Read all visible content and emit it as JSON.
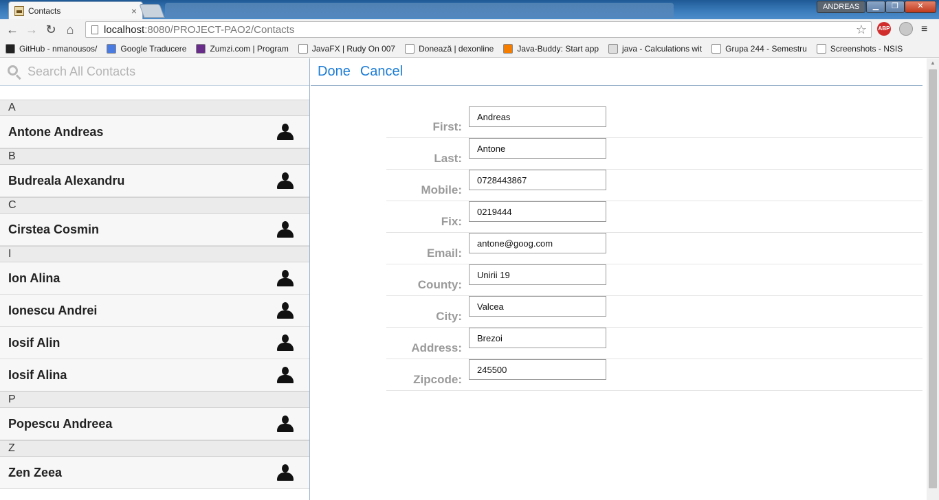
{
  "browser": {
    "tab_title": "Contacts",
    "tab_close": "×",
    "user_name": "ANDREAS",
    "url_host": "localhost",
    "url_path": ":8080/PROJECT-PAO2/Contacts",
    "abp_label": "ABP",
    "bookmarks": [
      {
        "label": "GitHub - nmanousos/",
        "icon": "github-icon",
        "color": "#222222"
      },
      {
        "label": "Google Traducere",
        "icon": "google-translate-icon",
        "color": "#4a7be0"
      },
      {
        "label": "Zumzi.com | Program",
        "icon": "zumzi-icon",
        "color": "#6a2c8a"
      },
      {
        "label": "JavaFX | Rudy On 007",
        "icon": "page-icon",
        "color": "#ffffff"
      },
      {
        "label": "Donează | dexonline",
        "icon": "dexonline-icon",
        "color": "#ffffff"
      },
      {
        "label": "Java-Buddy: Start app",
        "icon": "blogger-icon",
        "color": "#f57d00"
      },
      {
        "label": "java - Calculations wit",
        "icon": "globe-icon",
        "color": "#dddddd"
      },
      {
        "label": "Grupa 244 - Semestru",
        "icon": "x-icon",
        "color": "#ffffff"
      },
      {
        "label": "Screenshots - NSIS",
        "icon": "nsis-icon",
        "color": "#ffffff"
      }
    ]
  },
  "sidebar": {
    "search_placeholder": "Search All Contacts",
    "groups": [
      {
        "letter": "A",
        "contacts": [
          "Antone Andreas"
        ]
      },
      {
        "letter": "B",
        "contacts": [
          "Budreala Alexandru"
        ]
      },
      {
        "letter": "C",
        "contacts": [
          "Cirstea Cosmin"
        ]
      },
      {
        "letter": "I",
        "contacts": [
          "Ion Alina",
          "Ionescu Andrei",
          "Iosif Alin",
          "Iosif Alina"
        ]
      },
      {
        "letter": "P",
        "contacts": [
          "Popescu Andreea"
        ]
      },
      {
        "letter": "Z",
        "contacts": [
          "Zen Zeea"
        ]
      }
    ]
  },
  "editor": {
    "done_label": "Done",
    "cancel_label": "Cancel",
    "fields": [
      {
        "label": "First:",
        "value": "Andreas"
      },
      {
        "label": "Last:",
        "value": "Antone"
      },
      {
        "label": "Mobile:",
        "value": "0728443867"
      },
      {
        "label": "Fix:",
        "value": "0219444"
      },
      {
        "label": "Email:",
        "value": "antone@goog.com"
      },
      {
        "label": "County:",
        "value": "Unirii 19"
      },
      {
        "label": "City:",
        "value": "Valcea"
      },
      {
        "label": "Address:",
        "value": "Brezoi"
      },
      {
        "label": "Zipcode:",
        "value": "245500"
      }
    ]
  }
}
